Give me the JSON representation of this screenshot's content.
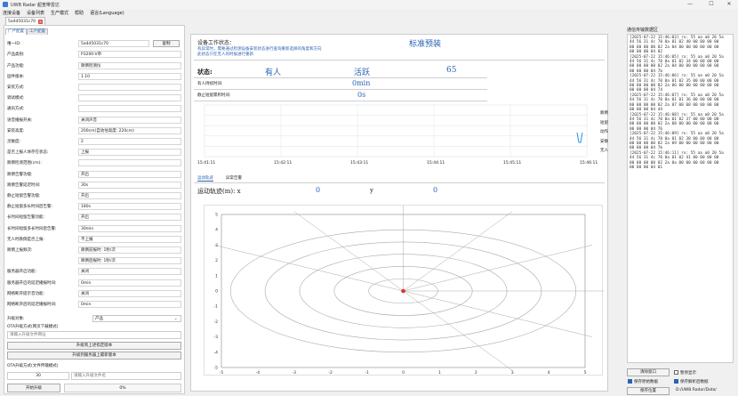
{
  "window": {
    "title": "UWB Radar 超宽带雷达",
    "minimize": "—",
    "maximize": "☐",
    "close": "✕"
  },
  "menu": [
    "连接设备",
    "设备列表",
    "生产模式",
    "帮助",
    "语言(Language)"
  ],
  "device_tab": {
    "label": "5a4d5031c70",
    "close": "✕"
  },
  "config_tabs": [
    "广严配置",
    "工产配置"
  ],
  "props": [
    {
      "label": "唯一ID:",
      "value": "5a4d5031c70"
    },
    {
      "label": "产品类别:",
      "value": "P3200-V单"
    },
    {
      "label": "产品功能:",
      "value": "跌倒检测仪"
    },
    {
      "label": "固件版本:",
      "value": "1.10"
    },
    {
      "label": "安装方式:",
      "value": ""
    },
    {
      "label": "调试模式:",
      "value": ""
    },
    {
      "label": "通讯方式:",
      "value": ""
    },
    {
      "label": "语音播报开关:",
      "value": "关闭声音"
    },
    {
      "label": "安装高度:",
      "value": "200cm(自动估高度: 220cm)"
    },
    {
      "label": "灵敏度:",
      "value": "2"
    },
    {
      "label": "是否上报人体存在状态:",
      "value": "上报"
    },
    {
      "label": "跌倒检测范围(cm):",
      "value": ""
    },
    {
      "label": "跌倒告警功能:",
      "value": "开启"
    },
    {
      "label": "跌倒告警延迟时间:",
      "value": "30s"
    },
    {
      "label": "静止短留告警功能:",
      "value": "开启"
    },
    {
      "label": "静止短留多长时间后告警:",
      "value": "180s"
    },
    {
      "label": "长时间短留告警功能:",
      "value": "开启"
    },
    {
      "label": "长时间短留多长时间后告警:",
      "value": "30min"
    },
    {
      "label": "无人时跌倒是否上报:",
      "value": "不上报"
    },
    {
      "label": "跌倒上报频次:",
      "value": "跌倒前报时: 1秒/次"
    },
    {
      "label": "",
      "value": "跌倒后报时: 1秒/次"
    },
    {
      "label": "服务器开启功能:",
      "value": "关闭"
    },
    {
      "label": "服务器开启的延迟播报时间:",
      "value": "0min"
    },
    {
      "label": "网络断开提示音功能:",
      "value": "关闭"
    },
    {
      "label": "网络断开后的延迟播报时间:",
      "value": "0min"
    }
  ],
  "copy_button": "复制",
  "upgrade": {
    "target_label": "升级对象:",
    "target_value": "产品",
    "ota_server_label": "OTA升级方式(网页下载模式)",
    "url_placeholder": "请输入升级文件网址",
    "btn_upgrade_url": "升级到上述指定版本",
    "btn_upgrade_latest": "升级到服务器上最新版本",
    "ota_file_label": "OTA升级方式(文件传输模式)",
    "size_value": "30",
    "file_placeholder": "请输入升级文件名",
    "btn_start": "开始升级",
    "progress_text": "0%"
  },
  "work": {
    "state_label": "设备工作状态：",
    "state_value": "标准预装",
    "note1": "有异常时，需要通过检测设备安装状态进行查询重新选择的角度和方向",
    "note2": "此状态只在无人的时候进行重新"
  },
  "status": {
    "label": "状态:",
    "presence": "有人",
    "activity": "活跃",
    "value": "65",
    "presence_time_label": "有人持续时间:",
    "presence_time": "0min",
    "still_time_label": "静止短留累积时间:",
    "still_time": "0s"
  },
  "timeline": {
    "times": [
      "15:41:11",
      "15:42:11",
      "15:43:11",
      "15:44:11",
      "15:45:11",
      "15:46:11"
    ],
    "legend": [
      "跌倒",
      "短留",
      "动作",
      "安静",
      "无人"
    ]
  },
  "subtabs": [
    "运动轨迹",
    "异常告警"
  ],
  "track": {
    "label": "运动轨迹(m): x",
    "x": "0",
    "ylabel": "y",
    "y": "0"
  },
  "chart_data": {
    "type": "scatter",
    "title": "运动轨迹(m)",
    "x": [
      0
    ],
    "y": [
      0
    ],
    "xlim": [
      -5,
      5
    ],
    "ylim": [
      -5,
      5
    ],
    "xticks": [
      "-5",
      "-4",
      "-3",
      "-2",
      "-1",
      "0",
      "1",
      "2",
      "3",
      "4",
      "5"
    ],
    "yticks": [
      "5",
      "4",
      "3",
      "2",
      "1",
      "0",
      "-1",
      "-2",
      "-3",
      "-4",
      "-5"
    ],
    "grid": "polar",
    "point_color": "#e03030"
  },
  "log": {
    "title": "通信传输数据区",
    "lines": [
      "[2025-07-22 15:46:03] rx: 55 aa a0 20 5a",
      "44 56 31 4c 70 0a 01 02 40 00 00 00 00",
      "00 00 00 00 02 2a 04 00 00 00 00 00 00",
      "00 00 00 04 02",
      "[2025-07-22 15:46:05] rx: 55 aa a0 20 5a",
      "44 56 31 4c 70 0a 01 02 34 00 00 00 00",
      "00 00 00 00 02 2a 04 00 00 00 00 00 00",
      "00 00 00 04 7b",
      "[2025-07-22 15:46:06] rx: 55 aa a0 20 5a",
      "44 56 31 4c 70 0a 01 02 35 00 00 00 00",
      "00 00 00 00 02 2a 06 00 00 00 00 00 00",
      "00 00 00 04 74",
      "[2025-07-22 15:46:07] rx: 55 aa a0 20 5a",
      "44 56 31 4c 70 0a 01 01 36 00 00 00 00",
      "00 00 00 00 02 2a 07 00 00 00 00 00 00",
      "00 00 00 04 44",
      "[2025-07-22 15:46:08] rx: 55 aa a0 20 5a",
      "44 56 31 4c 70 0a 01 02 37 00 00 00 00",
      "00 00 00 00 02 2a 08 00 00 00 00 00 00",
      "00 00 00 04 76",
      "[2025-07-22 15:46:09] rx: 55 aa a0 20 5a",
      "44 56 31 4c 70 0a 01 02 38 00 00 00 00",
      "00 00 00 00 02 2a 09 00 00 00 00 00 00",
      "00 00 00 04 7b",
      "[2025-07-22 15:46:11] rx: 55 aa a0 20 5a",
      "44 56 31 4c 70 0a 01 02 41 00 00 00 00",
      "00 00 00 00 02 2a 0a 00 00 00 00 00 00",
      "00 00 00 04 01"
    ],
    "clear_btn": "清除窗口",
    "pause_label": "暂停显示",
    "save_raw_label": "保存原始数据",
    "save_parsed_label": "保存解析后数据",
    "save_pos_btn": "保存位置",
    "save_path": "D:/UWB Radar/Data/"
  }
}
